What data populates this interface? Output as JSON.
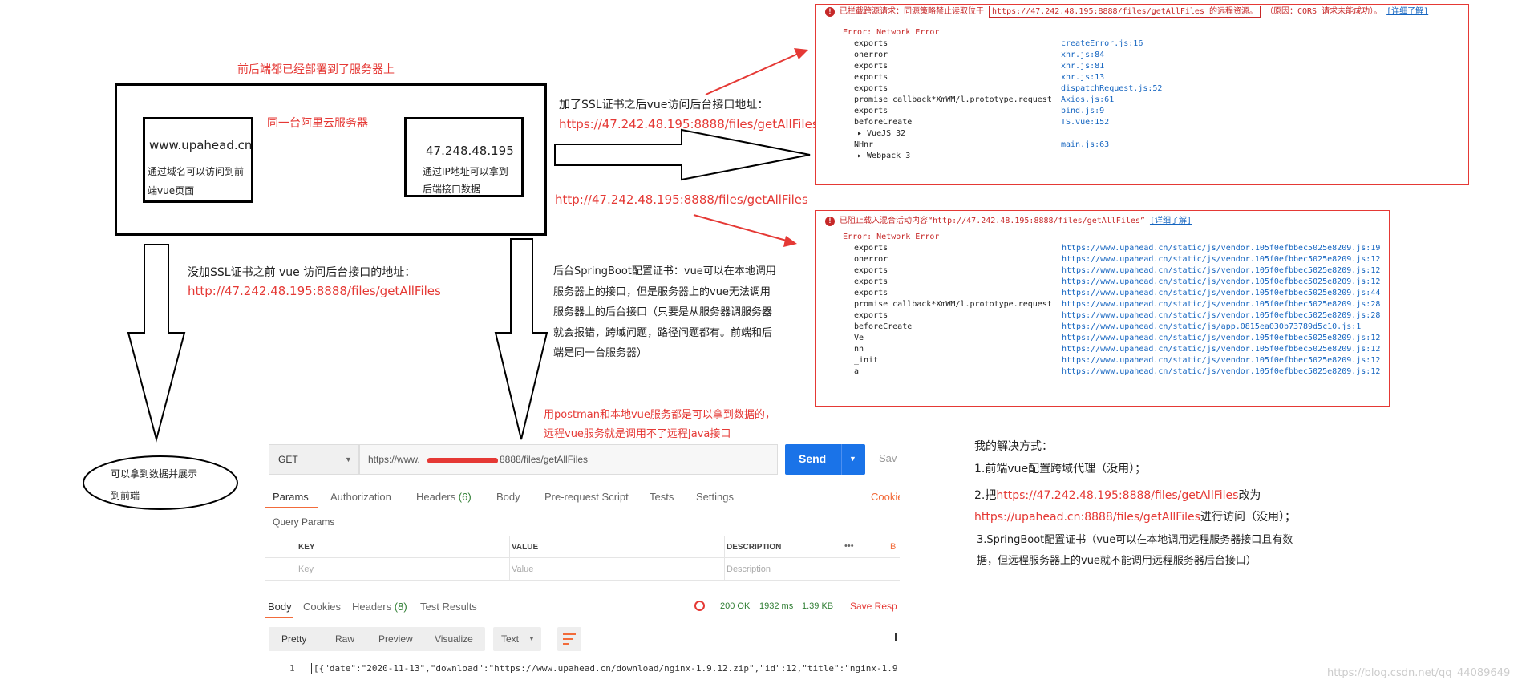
{
  "diagram": {
    "title_deployed": "前后端都已经部署到了服务器上",
    "same_server_label": "同一台阿里云服务器",
    "frontend_box": {
      "domain": "www.upahead.cn",
      "desc_line1": "通过域名可以访问到前",
      "desc_line2": "端vue页面"
    },
    "backend_box": {
      "ip": "47.248.48.195",
      "desc_line1": "通过IP地址可以拿到",
      "desc_line2": "后端接口数据"
    },
    "before_ssl_label": "没加SSL证书之前 vue 访问后台接口的地址：",
    "before_ssl_url": "http://47.242.48.195:8888/files/getAllFiles",
    "after_ssl_label": "加了SSL证书之后vue访问后台接口地址：",
    "after_ssl_url": "https://47.242.48.195:8888/files/getAllFiles",
    "http_url_middle": "http://47.242.48.195:8888/files/getAllFiles",
    "springboot_note": [
      "后台SpringBoot配置证书：vue可以在本地调用",
      "服务器上的接口，但是服务器上的vue无法调用",
      "服务器上的后台接口（只要是从服务器调服务器",
      "就会报错，跨域问题，路径问题都有。前端和后",
      "端是同一台服务器）"
    ],
    "postman_note": [
      "用postman和本地vue服务都是可以拿到数据的，",
      "远程vue服务就是调用不了远程Java接口"
    ],
    "ellipse_text": [
      "可以拿到数据并展示",
      "到前端"
    ],
    "solutions": {
      "title": "我的解决方式：",
      "item1": "1.前端vue配置跨域代理（没用）；",
      "item2_prefix": "2.把",
      "item2_url1": "https://47.242.48.195:8888/files/getAllFiles",
      "item2_mid": "改为",
      "item2_url2": "https://upahead.cn:8888/files/getAllFiles",
      "item2_suffix": "进行访问（没用）；",
      "item3_line1": "3.SpringBoot配置证书（vue可以在本地调用远程服务器接口且有数",
      "item3_line2": "据，但远程服务器上的vue就不能调用远程服务器后台接口）"
    }
  },
  "console_cors": {
    "header_text": "已拦截跨源请求：同源策略禁止读取位于",
    "header_url": "https://47.242.48.195:8888/files/getAllFiles 的远程资源。",
    "header_reason": "（原因：CORS 请求未能成功）。",
    "learn_more": "[详细了解]",
    "error_title": "Error: Network Error",
    "rows": [
      {
        "fn": "exports",
        "src": "createError.js:16"
      },
      {
        "fn": "onerror",
        "src": "xhr.js:84"
      },
      {
        "fn": "exports",
        "src": "xhr.js:81"
      },
      {
        "fn": "exports",
        "src": "xhr.js:13"
      },
      {
        "fn": "exports",
        "src": "dispatchRequest.js:52"
      },
      {
        "fn": "promise callback*XmWM/l.prototype.request",
        "src": "Axios.js:61"
      },
      {
        "fn": "exports",
        "src": "bind.js:9"
      },
      {
        "fn": "beforeCreate",
        "src": "TS.vue:152"
      },
      {
        "fn": "▸ VueJS 32",
        "src": ""
      },
      {
        "fn": "NHnr",
        "src": "main.js:63"
      },
      {
        "fn": "▸ Webpack 3",
        "src": ""
      }
    ]
  },
  "console_mixed": {
    "header_text": "已阻止载入混合活动内容“http://47.242.48.195:8888/files/getAllFiles”",
    "learn_more": "[详细了解]",
    "error_title": "Error: Network Error",
    "rows": [
      {
        "fn": "exports",
        "src": "https://www.upahead.cn/static/js/vendor.105f0efbbec5025e8209.js:19"
      },
      {
        "fn": "onerror",
        "src": "https://www.upahead.cn/static/js/vendor.105f0efbbec5025e8209.js:12"
      },
      {
        "fn": "exports",
        "src": "https://www.upahead.cn/static/js/vendor.105f0efbbec5025e8209.js:12"
      },
      {
        "fn": "exports",
        "src": "https://www.upahead.cn/static/js/vendor.105f0efbbec5025e8209.js:12"
      },
      {
        "fn": "exports",
        "src": "https://www.upahead.cn/static/js/vendor.105f0efbbec5025e8209.js:44"
      },
      {
        "fn": "promise callback*XmWM/l.prototype.request",
        "src": "https://www.upahead.cn/static/js/vendor.105f0efbbec5025e8209.js:28"
      },
      {
        "fn": "exports",
        "src": "https://www.upahead.cn/static/js/vendor.105f0efbbec5025e8209.js:28"
      },
      {
        "fn": "beforeCreate",
        "src": "https://www.upahead.cn/static/js/app.0815ea030b73789d5c10.js:1"
      },
      {
        "fn": "Ve",
        "src": "https://www.upahead.cn/static/js/vendor.105f0efbbec5025e8209.js:12"
      },
      {
        "fn": "nn",
        "src": "https://www.upahead.cn/static/js/vendor.105f0efbbec5025e8209.js:12"
      },
      {
        "fn": "_init",
        "src": "https://www.upahead.cn/static/js/vendor.105f0efbbec5025e8209.js:12"
      },
      {
        "fn": "a",
        "src": "https://www.upahead.cn/static/js/vendor.105f0efbbec5025e8209.js:12"
      }
    ]
  },
  "postman": {
    "method": "GET",
    "url_prefix": "https://www.",
    "url_suffix": "8888/files/getAllFiles",
    "send_label": "Send",
    "save_label": "Sav",
    "req_tabs": [
      "Params",
      "Authorization",
      "Headers",
      "Body",
      "Pre-request Script",
      "Tests",
      "Settings"
    ],
    "headers_count": "(6)",
    "cookies_link": "Cookie",
    "query_params_label": "Query Params",
    "table_headers": {
      "key": "KEY",
      "value": "VALUE",
      "description": "DESCRIPTION",
      "more": "•••",
      "bulk": "B"
    },
    "placeholders": {
      "key": "Key",
      "value": "Value",
      "description": "Description"
    },
    "resp_tabs": [
      "Body",
      "Cookies",
      "Headers",
      "Test Results"
    ],
    "resp_headers_count": "(8)",
    "status": "200 OK",
    "time": "1932 ms",
    "size": "1.39 KB",
    "save_response": "Save Resp",
    "view_modes": [
      "Pretty",
      "Raw",
      "Preview",
      "Visualize"
    ],
    "format": "Text",
    "line_number": "1",
    "response_body": "[{\"date\":\"2020-11-13\",\"download\":\"https://www.upahead.cn/download/nginx-1.9.12.zip\",\"id\":12,\"title\":\"nginx-1.9.",
    "bracket_hint": "["
  },
  "watermark": "https://blog.csdn.net/qq_44089649"
}
